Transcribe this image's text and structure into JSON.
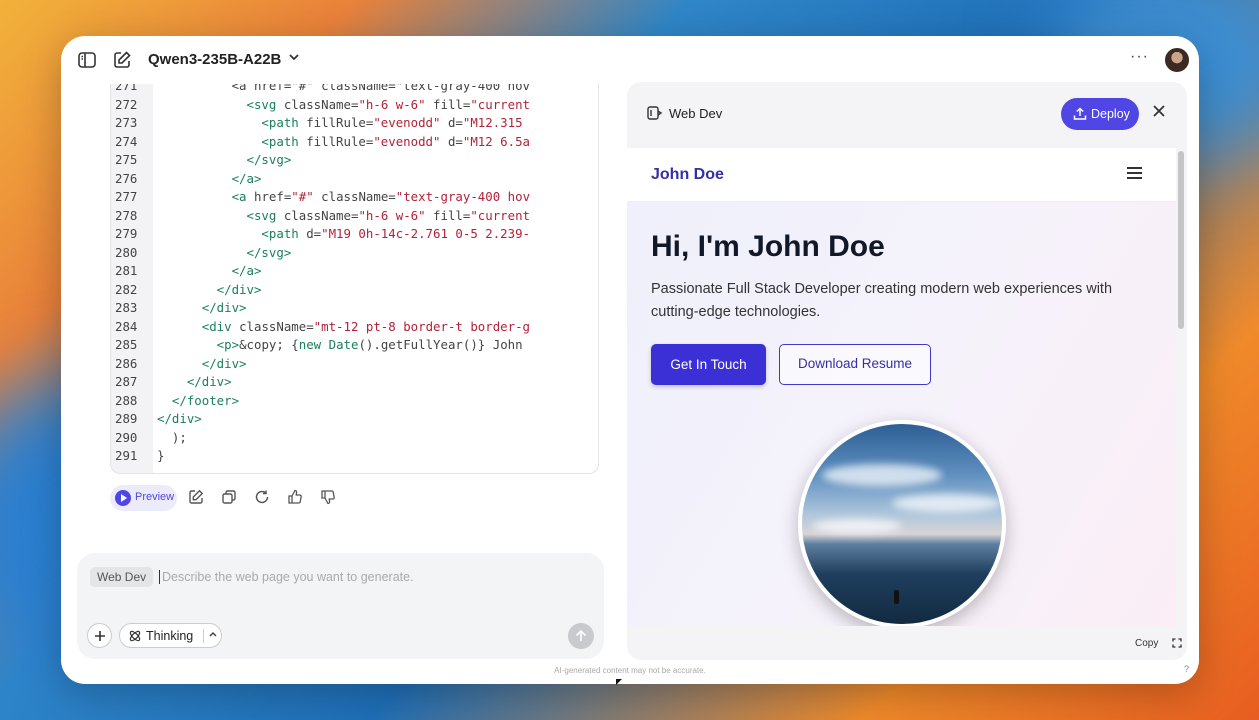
{
  "topbar": {
    "model_name": "Qwen3-235B-A22B",
    "more_label": "···"
  },
  "code": {
    "lines": [
      {
        "n": "271",
        "parts": [
          {
            "c": "t-attr",
            "t": "          <a href=\"#\" className=\"text-gray-400 hov"
          }
        ]
      },
      {
        "n": "272",
        "parts": [
          {
            "c": "t-tag",
            "t": "            <svg "
          },
          {
            "c": "t-attr",
            "t": "className="
          },
          {
            "c": "t-str",
            "t": "\"h-6 w-6\""
          },
          {
            "c": "t-attr",
            "t": " fill="
          },
          {
            "c": "t-str",
            "t": "\"current"
          }
        ]
      },
      {
        "n": "273",
        "parts": [
          {
            "c": "t-tag",
            "t": "              <path "
          },
          {
            "c": "t-attr",
            "t": "fillRule="
          },
          {
            "c": "t-str",
            "t": "\"evenodd\""
          },
          {
            "c": "t-attr",
            "t": " d="
          },
          {
            "c": "t-str",
            "t": "\"M12.315"
          }
        ]
      },
      {
        "n": "274",
        "parts": [
          {
            "c": "t-tag",
            "t": "              <path "
          },
          {
            "c": "t-attr",
            "t": "fillRule="
          },
          {
            "c": "t-str",
            "t": "\"evenodd\""
          },
          {
            "c": "t-attr",
            "t": " d="
          },
          {
            "c": "t-str",
            "t": "\"M12 6.5a"
          }
        ]
      },
      {
        "n": "275",
        "parts": [
          {
            "c": "t-tag",
            "t": "            </svg>"
          }
        ]
      },
      {
        "n": "276",
        "parts": [
          {
            "c": "t-tag",
            "t": "          </a>"
          }
        ]
      },
      {
        "n": "277",
        "parts": [
          {
            "c": "t-tag",
            "t": "          <a "
          },
          {
            "c": "t-attr",
            "t": "href="
          },
          {
            "c": "t-str",
            "t": "\"#\""
          },
          {
            "c": "t-attr",
            "t": " className="
          },
          {
            "c": "t-str",
            "t": "\"text-gray-400 hov"
          }
        ]
      },
      {
        "n": "278",
        "parts": [
          {
            "c": "t-tag",
            "t": "            <svg "
          },
          {
            "c": "t-attr",
            "t": "className="
          },
          {
            "c": "t-str",
            "t": "\"h-6 w-6\""
          },
          {
            "c": "t-attr",
            "t": " fill="
          },
          {
            "c": "t-str",
            "t": "\"current"
          }
        ]
      },
      {
        "n": "279",
        "parts": [
          {
            "c": "t-tag",
            "t": "              <path "
          },
          {
            "c": "t-attr",
            "t": "d="
          },
          {
            "c": "t-str",
            "t": "\"M19 0h-14c-2.761 0-5 2.239-"
          }
        ]
      },
      {
        "n": "280",
        "parts": [
          {
            "c": "t-tag",
            "t": "            </svg>"
          }
        ]
      },
      {
        "n": "281",
        "parts": [
          {
            "c": "t-tag",
            "t": "          </a>"
          }
        ]
      },
      {
        "n": "282",
        "parts": [
          {
            "c": "t-tag",
            "t": "        </div>"
          }
        ]
      },
      {
        "n": "283",
        "parts": [
          {
            "c": "t-tag",
            "t": "      </div>"
          }
        ]
      },
      {
        "n": "284",
        "parts": [
          {
            "c": "t-tag",
            "t": "      <div "
          },
          {
            "c": "t-attr",
            "t": "className="
          },
          {
            "c": "t-str",
            "t": "\"mt-12 pt-8 border-t border-g"
          }
        ]
      },
      {
        "n": "285",
        "parts": [
          {
            "c": "t-tag",
            "t": "        <p>"
          },
          {
            "c": "t-attr",
            "t": "&copy; {"
          },
          {
            "c": "t-kw",
            "t": "new"
          },
          {
            "c": "t-attr",
            "t": " "
          },
          {
            "c": "t-kw",
            "t": "Date"
          },
          {
            "c": "t-attr",
            "t": "().getFullYear()} John"
          }
        ]
      },
      {
        "n": "286",
        "parts": [
          {
            "c": "t-tag",
            "t": "      </div>"
          }
        ]
      },
      {
        "n": "287",
        "parts": [
          {
            "c": "t-tag",
            "t": "    </div>"
          }
        ]
      },
      {
        "n": "288",
        "parts": [
          {
            "c": "t-tag",
            "t": "  </footer>"
          }
        ]
      },
      {
        "n": "289",
        "parts": [
          {
            "c": "t-tag",
            "t": "</div>"
          }
        ]
      },
      {
        "n": "290",
        "parts": [
          {
            "c": "t-attr",
            "t": "  );"
          }
        ]
      },
      {
        "n": "291",
        "parts": [
          {
            "c": "t-attr",
            "t": "}"
          }
        ]
      }
    ]
  },
  "actions": {
    "preview_label": "Preview"
  },
  "input": {
    "mode_tag": "Web Dev",
    "placeholder": "Describe the web page you want to generate.",
    "thinking_label": "Thinking"
  },
  "footer": {
    "disclaimer": "AI-generated content may not be accurate.",
    "help": "?"
  },
  "panel": {
    "title": "Web Dev",
    "deploy_label": "Deploy",
    "copy_label": "Copy",
    "preview": {
      "brand": "John Doe",
      "heading": "Hi, I'm John Doe",
      "subtitle": "Passionate Full Stack Developer creating modern web experiences with cutting-edge technologies.",
      "primary_button": "Get In Touch",
      "secondary_button": "Download Resume"
    }
  },
  "colors": {
    "accent": "#5046e5",
    "brand_text": "#3730a3"
  }
}
